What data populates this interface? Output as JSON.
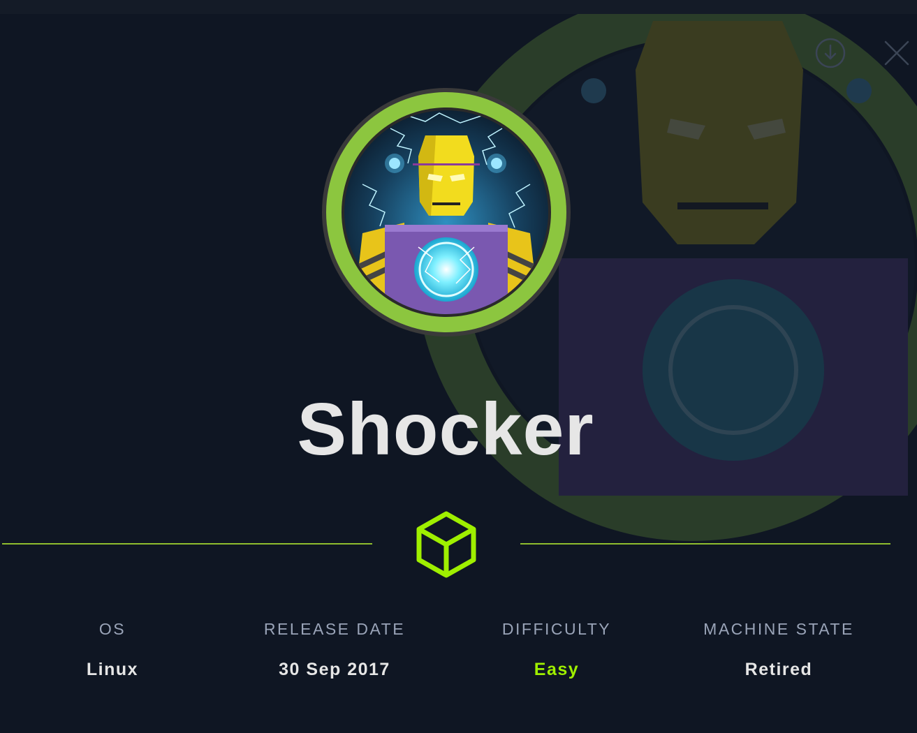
{
  "machine": {
    "name": "Shocker"
  },
  "info": {
    "os_label": "OS",
    "os_value": "Linux",
    "release_label": "RELEASE DATE",
    "release_value": "30 Sep 2017",
    "difficulty_label": "DIFFICULTY",
    "difficulty_value": "Easy",
    "state_label": "MACHINE STATE",
    "state_value": "Retired"
  },
  "icons": {
    "download": "download-circle-icon",
    "close": "close-icon",
    "cube": "cube-icon"
  },
  "colors": {
    "background": "#0f1623",
    "accent_green": "#9fef00",
    "ring_green": "#8cc63f",
    "label_gray": "#9aa4b8",
    "text_white": "#e6e6e6"
  }
}
